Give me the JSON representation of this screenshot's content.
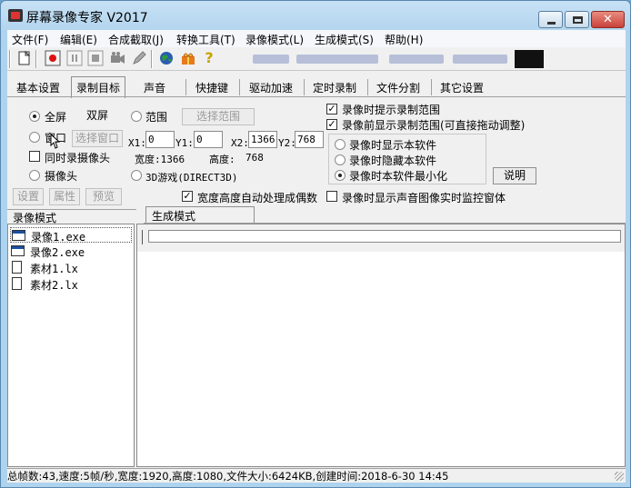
{
  "window": {
    "title": "屏幕录像专家 V2017"
  },
  "menu": [
    "文件(F)",
    "编辑(E)",
    "合成截取(J)",
    "转换工具(T)",
    "录像模式(L)",
    "生成模式(S)",
    "帮助(H)"
  ],
  "toolbar": {
    "icons": [
      "new-document-icon",
      "record-icon",
      "pause-icon",
      "stop-icon",
      "camera-icon",
      "pen-icon",
      "globe-icon",
      "gift-icon",
      "help-icon"
    ],
    "help_glyph": "?"
  },
  "tabs": [
    "基本设置",
    "录制目标",
    "声音",
    "快捷键",
    "驱动加速",
    "定时录制",
    "文件分割",
    "其它设置"
  ],
  "active_tab": "录制目标",
  "target": {
    "fullscreen": "全屏",
    "dual_screen": "双屏",
    "range": "范围",
    "select_range": "选择范围",
    "window": "窗口",
    "select_window": "选择窗口",
    "x1_label": "X1:",
    "x1": "0",
    "y1_label": "Y1:",
    "y1": "0",
    "x2_label": "X2:",
    "x2": "1366",
    "y2_label": "Y2:",
    "y2": "768",
    "width_label": "宽度:1366",
    "height_label": "高度:",
    "height_value": "768",
    "record_camera_too": "同时录摄像头",
    "camera": "摄像头",
    "game_3d": "3D游戏(DIRECT3D)",
    "settings_btn": "设置",
    "props_btn": "属性",
    "preview_btn": "预览",
    "even_size": "宽度高度自动处理成偶数"
  },
  "options": {
    "hint_range": "录像时提示录制范围",
    "show_range_before": "录像前显示录制范围(可直接拖动调整)",
    "show_software": "录像时显示本软件",
    "hide_software": "录像时隐藏本软件",
    "minimize_software": "录像时本软件最小化",
    "explain_btn": "说明",
    "monitor_window": "录像时显示声音图像实时监控窗体"
  },
  "left_panel": {
    "header": "录像模式",
    "items": [
      {
        "label": "录像1.exe",
        "icon": "exe-window-icon"
      },
      {
        "label": "录像2.exe",
        "icon": "exe-window-icon"
      },
      {
        "label": "素材1.lx",
        "icon": "document-icon"
      },
      {
        "label": "素材2.lx",
        "icon": "document-icon"
      }
    ]
  },
  "right_panel": {
    "tab": "生成模式"
  },
  "status": "总帧数:43,速度:5帧/秒,宽度:1920,高度:1080,文件大小:6424KB,创建时间:2018-6-30 14:45"
}
